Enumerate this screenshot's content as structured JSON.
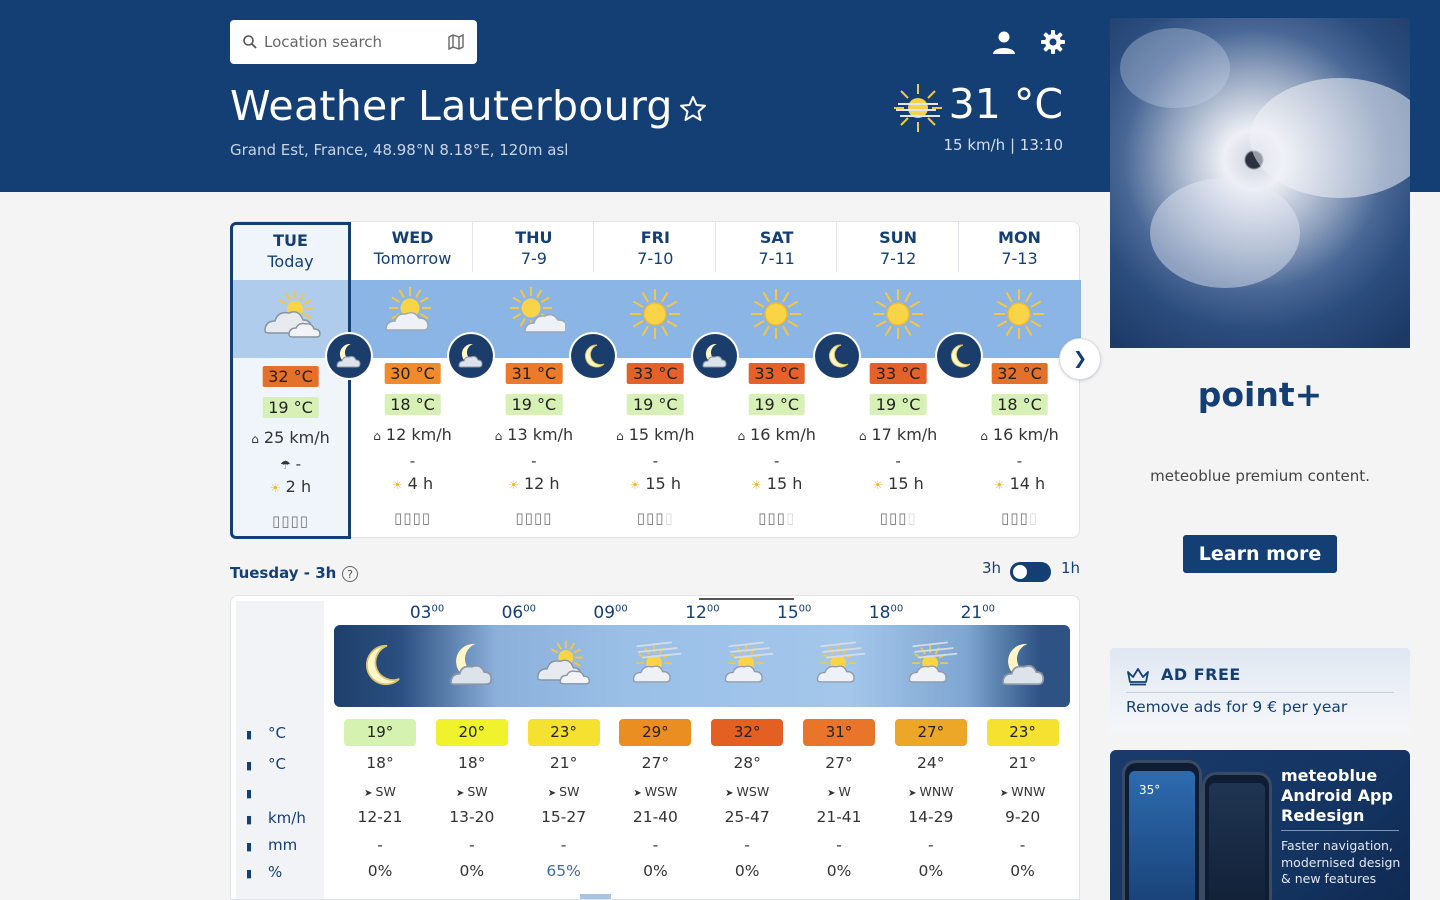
{
  "header": {
    "search_placeholder": "Location search",
    "title": "Weather Lauterbourg",
    "subtitle": "Grand Est, France, 48.98°N 8.18°E, 120m asl",
    "current_temp": "31 °C",
    "current_info": "15 km/h  | 13:10"
  },
  "week": [
    {
      "day": "TUE",
      "date": "Today",
      "tmax": "32 °C",
      "tmin": "19 °C",
      "wind": "25 km/h",
      "prec": "-",
      "sun": "2 h",
      "pred": "",
      "tmax_color": "#e4702a",
      "tmin_color": "#d7f0b5",
      "icon": "cloudy-icon"
    },
    {
      "day": "WED",
      "date": "Tomorrow",
      "tmax": "30 °C",
      "tmin": "18 °C",
      "wind": "12 km/h",
      "prec": "-",
      "sun": "4 h",
      "pred": "",
      "tmax_color": "#f08a2a",
      "tmin_color": "#d7f0b5",
      "icon": "partly-cloudy-icon"
    },
    {
      "day": "THU",
      "date": "7-9",
      "tmax": "31 °C",
      "tmin": "19 °C",
      "wind": "13 km/h",
      "prec": "-",
      "sun": "12 h",
      "pred": "",
      "tmax_color": "#eb7b2b",
      "tmin_color": "#d7f0b5",
      "icon": "sun-cloud-icon"
    },
    {
      "day": "FRI",
      "date": "7-10",
      "tmax": "33 °C",
      "tmin": "19 °C",
      "wind": "15 km/h",
      "prec": "-",
      "sun": "15 h",
      "pred": "",
      "tmax_color": "#e4612a",
      "tmin_color": "#d7f0b5",
      "icon": "sun-icon"
    },
    {
      "day": "SAT",
      "date": "7-11",
      "tmax": "33 °C",
      "tmin": "19 °C",
      "wind": "16 km/h",
      "prec": "-",
      "sun": "15 h",
      "pred": "",
      "tmax_color": "#e4612a",
      "tmin_color": "#d7f0b5",
      "icon": "sun-icon"
    },
    {
      "day": "SUN",
      "date": "7-12",
      "tmax": "33 °C",
      "tmin": "19 °C",
      "wind": "17 km/h",
      "prec": "-",
      "sun": "15 h",
      "pred": "",
      "tmax_color": "#e4612a",
      "tmin_color": "#d7f0b5",
      "icon": "sun-icon"
    },
    {
      "day": "MON",
      "date": "7-13",
      "tmax": "32 °C",
      "tmin": "18 °C",
      "wind": "16 km/h",
      "prec": "-",
      "sun": "14 h",
      "pred": "",
      "tmax_color": "#e4702a",
      "tmin_color": "#d7f0b5",
      "icon": "sun-icon"
    }
  ],
  "hourly": {
    "label": "Tuesday - 3h",
    "help": "?",
    "toggle_3h": "3h",
    "toggle_1h": "1h",
    "hours": [
      {
        "h": "03",
        "m": "00"
      },
      {
        "h": "06",
        "m": "00"
      },
      {
        "h": "09",
        "m": "00"
      },
      {
        "h": "12",
        "m": "00"
      },
      {
        "h": "15",
        "m": "00"
      },
      {
        "h": "18",
        "m": "00"
      },
      {
        "h": "21",
        "m": "00"
      }
    ],
    "row_labels": {
      "temp": "°C",
      "felt": "°C",
      "dir": "",
      "wind": "km/h",
      "prec": "mm",
      "prob": "%"
    },
    "columns": [
      {
        "temp": "19°",
        "felt": "18°",
        "dir": "SW",
        "wind": "12-21",
        "prec": "-",
        "prob": "0%",
        "color": "#d6f2b0"
      },
      {
        "temp": "20°",
        "felt": "18°",
        "dir": "SW",
        "wind": "13-20",
        "prec": "-",
        "prob": "0%",
        "color": "#f0f22e"
      },
      {
        "temp": "23°",
        "felt": "21°",
        "dir": "SW",
        "wind": "15-27",
        "prec": "-",
        "prob": "65%",
        "color": "#f5e130"
      },
      {
        "temp": "29°",
        "felt": "27°",
        "dir": "WSW",
        "wind": "21-40",
        "prec": "-",
        "prob": "0%",
        "color": "#eb8e22"
      },
      {
        "temp": "32°",
        "felt": "28°",
        "dir": "WSW",
        "wind": "25-47",
        "prec": "-",
        "prob": "0%",
        "color": "#e35f22"
      },
      {
        "temp": "31°",
        "felt": "27°",
        "dir": "W",
        "wind": "21-41",
        "prec": "-",
        "prob": "0%",
        "color": "#e8752a"
      },
      {
        "temp": "27°",
        "felt": "24°",
        "dir": "WNW",
        "wind": "14-29",
        "prec": "-",
        "prob": "0%",
        "color": "#eca628"
      },
      {
        "temp": "23°",
        "felt": "21°",
        "dir": "WNW",
        "wind": "9-20",
        "prec": "-",
        "prob": "0%",
        "color": "#f5e130"
      }
    ]
  },
  "ads": {
    "point_plus": "point+",
    "premium": "meteoblue premium content.",
    "learn_more": "Learn more",
    "adfree_title": "AD FREE",
    "adfree_text": "Remove ads for 9 € per year",
    "app_title": "meteoblue Android App Redesign",
    "app_desc": "Faster navigation, modernised design & new features",
    "phone_temp": "35°"
  }
}
